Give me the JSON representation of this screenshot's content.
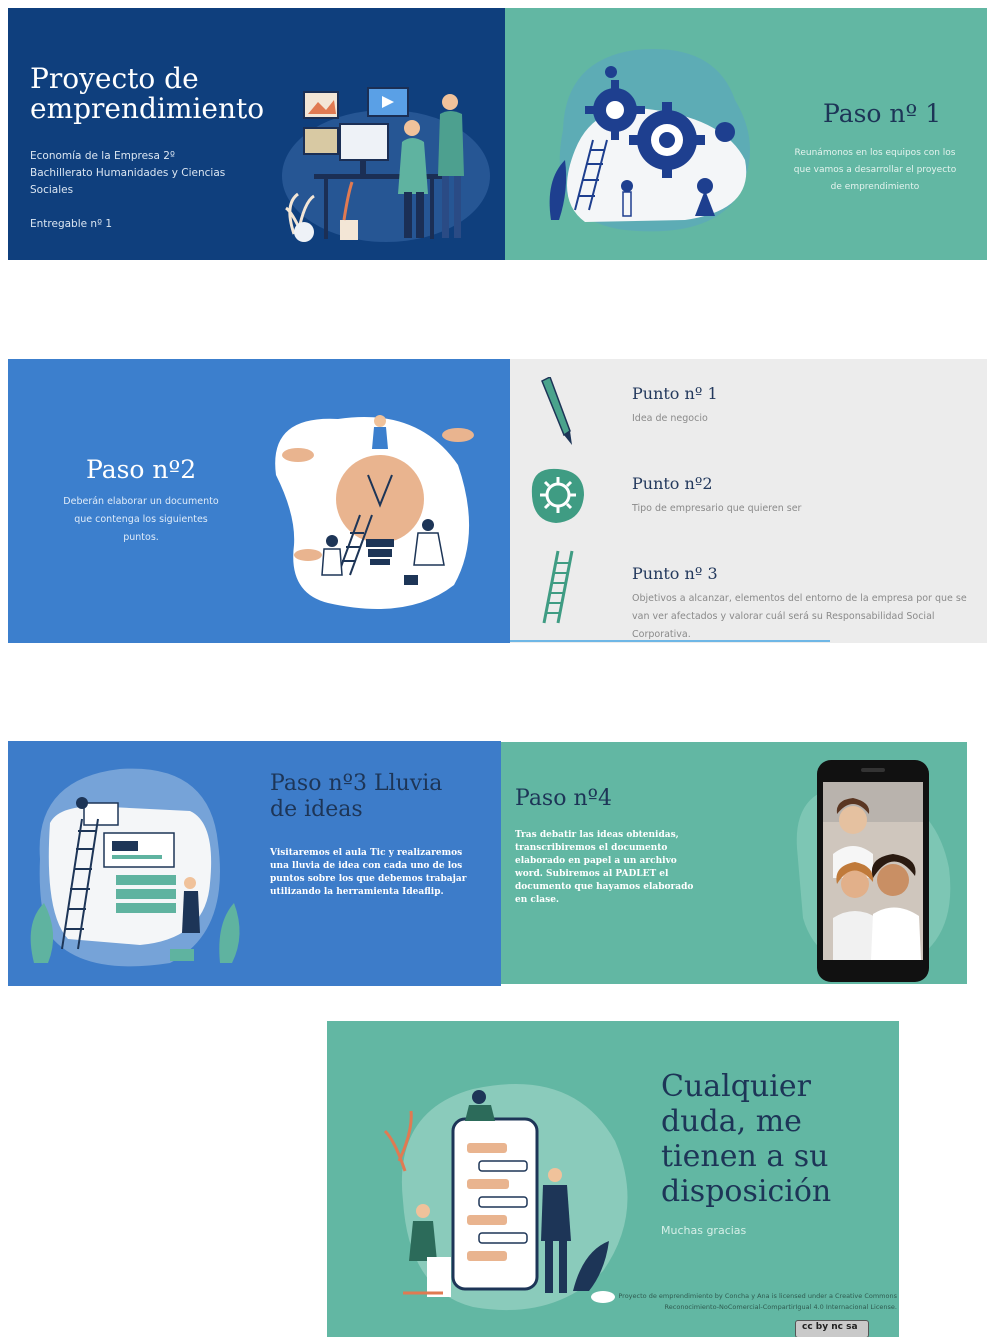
{
  "slide1": {
    "title": "Proyecto de emprendimiento",
    "subtitle": "Economía de la Empresa 2º Bachillerato Humanidades y Ciencias Sociales",
    "deliverable": "Entregable nº 1"
  },
  "slide2": {
    "title": "Paso nº 1",
    "body": "Reunámonos en los equipos con los que vamos a desarrollar el proyecto de emprendimiento"
  },
  "slide3": {
    "title": "Paso nº2",
    "body": "Deberán elaborar un documento que contenga los siguientes puntos."
  },
  "slide4": {
    "points": [
      {
        "title": "Punto nº 1",
        "desc": "Idea de negocio"
      },
      {
        "title": "Punto nº2",
        "desc": "Tipo de empresario que quieren ser"
      },
      {
        "title": "Punto nº 3",
        "desc": "Objetivos a alcanzar, elementos del entorno de la empresa por que se van ver afectados y valorar cuál será su Responsabilidad Social Corporativa."
      }
    ]
  },
  "slide5": {
    "title": "Paso nº3 Lluvia de ideas",
    "body": "Visitaremos el aula Tic y realizaremos una lluvia de idea con cada uno de los puntos sobre los que debemos trabajar utilizando la herramienta Ideaflip."
  },
  "slide6": {
    "title": "Paso nº4",
    "body": "Tras debatir las ideas obtenidas, transcribiremos el documento elaborado en papel a un archivo word. Subiremos al PADLET el documento que hayamos elaborado en clase."
  },
  "slide7": {
    "title": "Cualquier duda, me tienen a su disposición",
    "thanks": "Muchas gracias",
    "license": "Proyecto de emprendimiento by Concha y Ana is licensed under a Creative Commons Reconocimiento-NoComercial-CompartirIgual 4.0 Internacional License.",
    "badge": "cc by nc sa"
  },
  "colors": {
    "navy": "#0f3f7d",
    "teal": "#62b7a3",
    "blue": "#3c7fcd",
    "light_gray": "#ececec",
    "dark_text": "#1d3557"
  }
}
